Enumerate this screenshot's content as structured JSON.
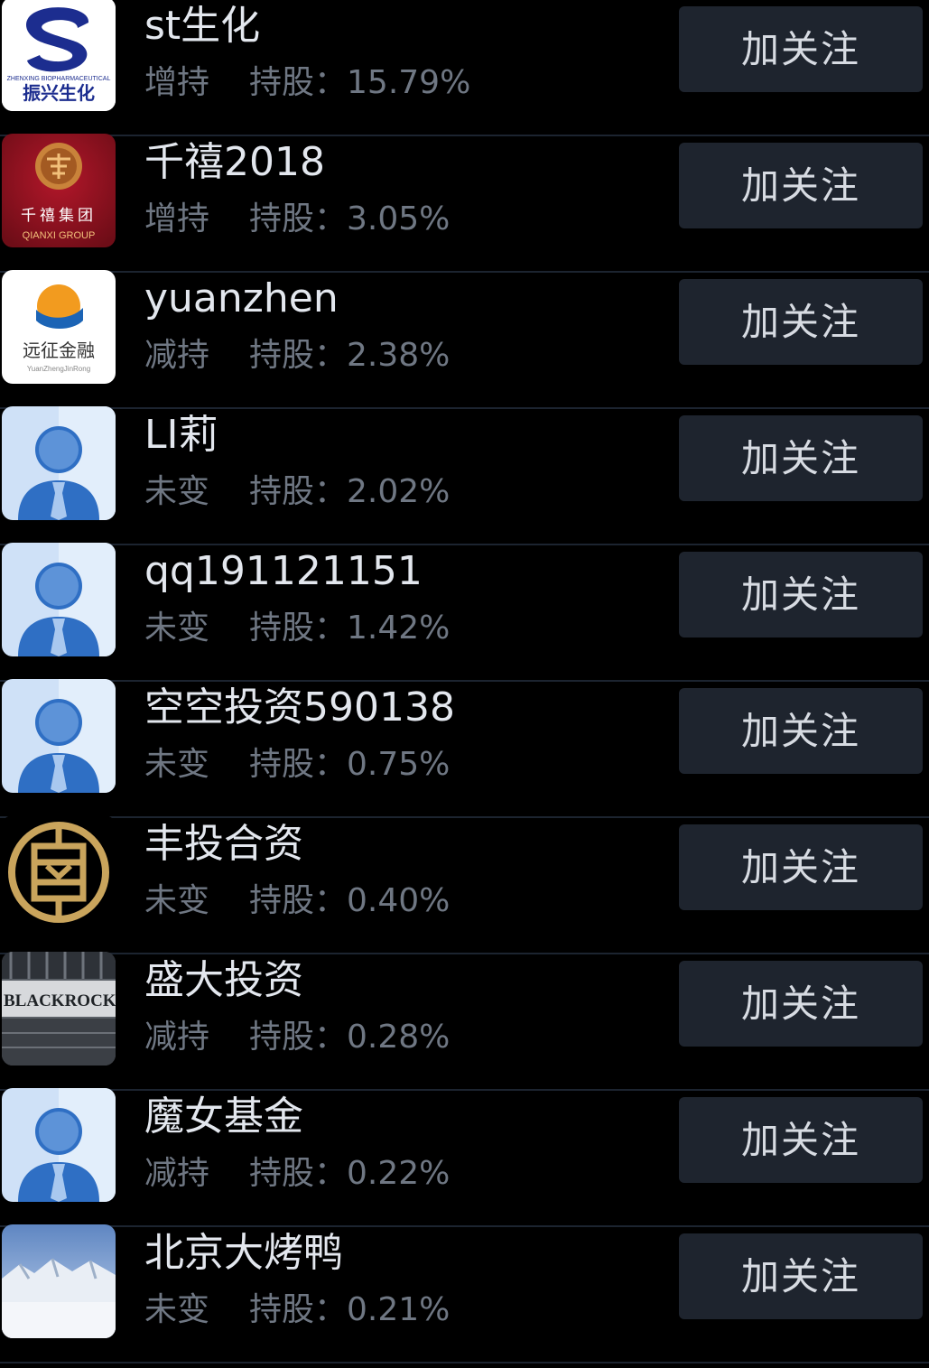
{
  "follow_label": "加关注",
  "holding_label": "持股：",
  "rows": [
    {
      "name": "st生化",
      "status": "增持",
      "share": "15.79%",
      "avatar": "zhenxing-logo",
      "logo_text": "振兴生化",
      "logo_subtext": "ZHENXING BIOPHARMACEUTICAL"
    },
    {
      "name": "千禧2018",
      "status": "增持",
      "share": "3.05%",
      "avatar": "qianxi-logo",
      "logo_text": "千禧集团",
      "logo_subtext": "QIANXI GROUP"
    },
    {
      "name": "yuanzhen",
      "status": "减持",
      "share": "2.38%",
      "avatar": "yuanzheng-logo",
      "logo_text": "远征金融",
      "logo_subtext": "YuanZhengJinRong"
    },
    {
      "name": "LI莉",
      "status": "未变",
      "share": "2.02%",
      "avatar": "default-person-avatar"
    },
    {
      "name": "qq191121151",
      "status": "未变",
      "share": "1.42%",
      "avatar": "default-person-avatar"
    },
    {
      "name": "空空投资590138",
      "status": "未变",
      "share": "0.75%",
      "avatar": "default-person-avatar"
    },
    {
      "name": "丰投合资",
      "status": "未变",
      "share": "0.40%",
      "avatar": "gold-emblem-logo"
    },
    {
      "name": "盛大投资",
      "status": "减持",
      "share": "0.28%",
      "avatar": "blackrock-photo",
      "logo_text": "BLACKROCK"
    },
    {
      "name": "魔女基金",
      "status": "减持",
      "share": "0.22%",
      "avatar": "default-person-avatar"
    },
    {
      "name": "北京大烤鸭",
      "status": "未变",
      "share": "0.21%",
      "avatar": "snow-mountain-photo"
    }
  ]
}
